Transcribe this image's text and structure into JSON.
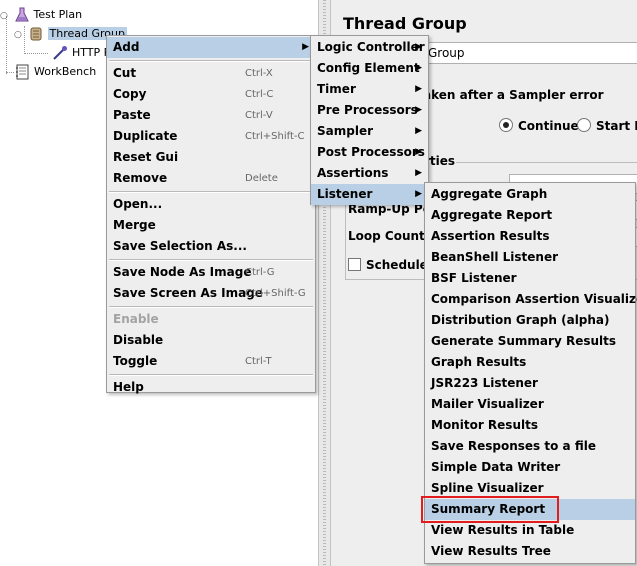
{
  "tree": {
    "nodes": [
      {
        "label": "Test Plan",
        "icon": "beaker-icon"
      },
      {
        "label": "Thread Group",
        "icon": "thread-group-icon"
      },
      {
        "label": "HTTP R",
        "icon": "pipette-icon"
      },
      {
        "label": "WorkBench",
        "icon": "notebook-icon"
      }
    ]
  },
  "content": {
    "title": "Thread Group",
    "name_value": "Group",
    "error_label": "aken after a Sampler error",
    "radio_continue": "Continue",
    "radio_start": "Start Ne",
    "props_label": "rties",
    "rampup_label": "Ramp-Up Per",
    "loop_label": "Loop Count:",
    "scheduler_label": "Scheduler"
  },
  "context_menu": {
    "items": [
      {
        "label": "Add",
        "submenu": true,
        "highlight": true
      },
      {
        "separator": true
      },
      {
        "label": "Cut",
        "accel": "Ctrl-X"
      },
      {
        "label": "Copy",
        "accel": "Ctrl-C"
      },
      {
        "label": "Paste",
        "accel": "Ctrl-V"
      },
      {
        "label": "Duplicate",
        "accel": "Ctrl+Shift-C"
      },
      {
        "label": "Reset Gui"
      },
      {
        "label": "Remove",
        "accel": "Delete"
      },
      {
        "separator": true
      },
      {
        "label": "Open..."
      },
      {
        "label": "Merge"
      },
      {
        "label": "Save Selection As..."
      },
      {
        "separator": true
      },
      {
        "label": "Save Node As Image",
        "accel": "Ctrl-G"
      },
      {
        "label": "Save Screen As Image",
        "accel": "Ctrl+Shift-G"
      },
      {
        "separator": true
      },
      {
        "label": "Enable",
        "disabled": true
      },
      {
        "label": "Disable"
      },
      {
        "label": "Toggle",
        "accel": "Ctrl-T"
      },
      {
        "separator": true
      },
      {
        "label": "Help"
      }
    ]
  },
  "add_menu": {
    "items": [
      {
        "label": "Logic Controller"
      },
      {
        "label": "Config Element"
      },
      {
        "label": "Timer"
      },
      {
        "label": "Pre Processors"
      },
      {
        "label": "Sampler"
      },
      {
        "label": "Post Processors"
      },
      {
        "label": "Assertions"
      },
      {
        "label": "Listener",
        "highlight": true
      }
    ]
  },
  "listener_menu": {
    "items": [
      {
        "label": "Aggregate Graph"
      },
      {
        "label": "Aggregate Report"
      },
      {
        "label": "Assertion Results"
      },
      {
        "label": "BeanShell Listener"
      },
      {
        "label": "BSF Listener"
      },
      {
        "label": "Comparison Assertion Visualizer"
      },
      {
        "label": "Distribution Graph (alpha)"
      },
      {
        "label": "Generate Summary Results"
      },
      {
        "label": "Graph Results"
      },
      {
        "label": "JSR223 Listener"
      },
      {
        "label": "Mailer Visualizer"
      },
      {
        "label": "Monitor Results"
      },
      {
        "label": "Save Responses to a file"
      },
      {
        "label": "Simple Data Writer"
      },
      {
        "label": "Spline Visualizer"
      },
      {
        "label": "Summary Report",
        "highlight": true,
        "annotated": true
      },
      {
        "label": "View Results in Table"
      },
      {
        "label": "View Results Tree"
      }
    ]
  },
  "colors": {
    "highlight": "#b8cfe5",
    "annotation": "#e01e1e",
    "menu_bg": "#eeeeee"
  },
  "submenu_arrow": "▶"
}
